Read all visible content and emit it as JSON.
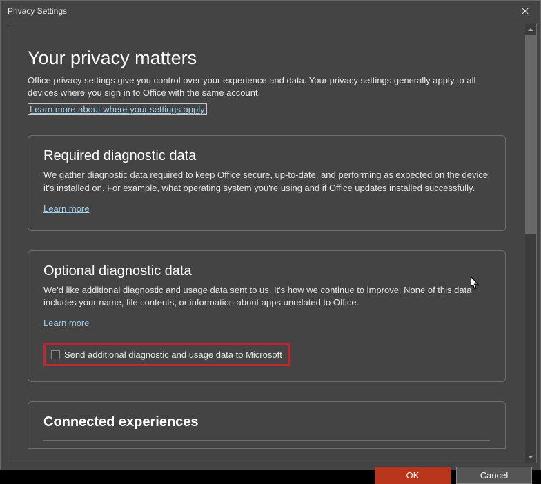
{
  "titlebar": {
    "title": "Privacy Settings"
  },
  "header": {
    "heading": "Your privacy matters",
    "intro": "Office privacy settings give you control over your experience and data. Your privacy settings generally apply to all devices where you sign in to Office with the same account.",
    "learn_more": "Learn more about where your settings apply"
  },
  "required": {
    "heading": "Required diagnostic data",
    "body": "We gather diagnostic data required to keep Office secure, up-to-date, and performing as expected on the device it's installed on. For example, what operating system you're using and if Office updates installed successfully.",
    "learn_more": "Learn more"
  },
  "optional": {
    "heading": "Optional diagnostic data",
    "body": "We'd like additional diagnostic and usage data sent to us. It's how we continue to improve. None of this data includes your name, file contents, or information about apps unrelated to Office.",
    "learn_more": "Learn more",
    "checkbox_label": "Send additional diagnostic and usage data to Microsoft"
  },
  "connected": {
    "heading": "Connected experiences"
  },
  "buttons": {
    "ok": "OK",
    "cancel": "Cancel"
  }
}
